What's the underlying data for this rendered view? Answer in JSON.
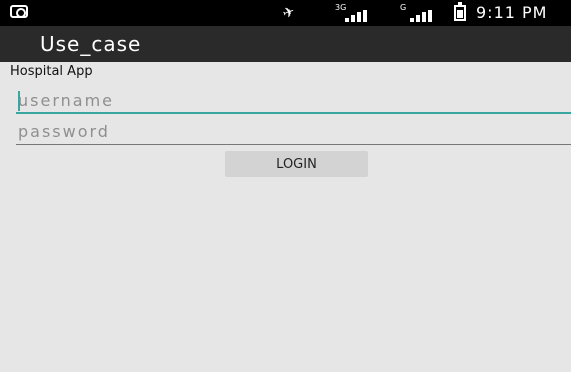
{
  "status_bar": {
    "time": "9:11 PM",
    "signal_1_type": "3G",
    "signal_2_type": "G",
    "icons": [
      "app-icon",
      "rotation-lock-icon",
      "signal-icon",
      "signal-icon",
      "battery-icon"
    ]
  },
  "action_bar": {
    "title": "Use_case",
    "background": "#2a2a2a"
  },
  "content": {
    "app_label": "Hospital App",
    "username_placeholder": "username",
    "password_placeholder": "password",
    "login_label": "LOGIN",
    "accent_color": "#3aa6a0"
  }
}
